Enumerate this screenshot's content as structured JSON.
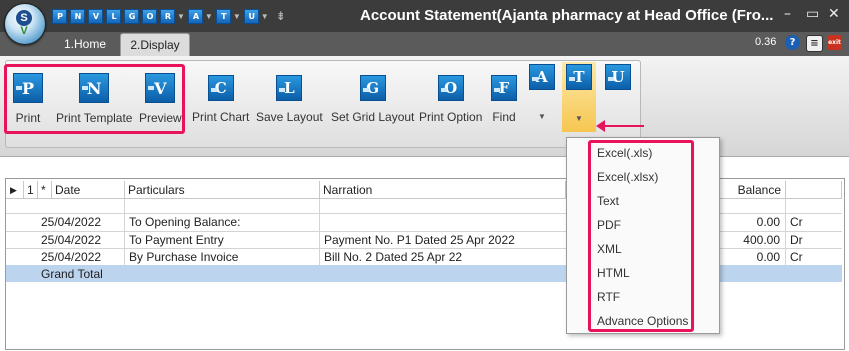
{
  "app": {
    "title": "Account Statement(Ajanta pharmacy  at Head Office (Fro...",
    "qat": [
      "P",
      "N",
      "V",
      "L",
      "G",
      "O",
      "R",
      "A",
      "T",
      "U"
    ],
    "qat_with_dropdown": [
      "R",
      "A",
      "T"
    ],
    "window_controls": {
      "minimize": "–",
      "maximize": "▭",
      "close": "✕"
    }
  },
  "tabs": [
    {
      "label": "1.Home",
      "active": false
    },
    {
      "label": "2.Display",
      "active": true
    }
  ],
  "header_right": {
    "zoom": "0.36",
    "help_icon": "?",
    "doc_icon": "≡",
    "exit_icon": "exit"
  },
  "ribbon": {
    "buttons": [
      {
        "id": "print",
        "icon": "P",
        "label": "Print"
      },
      {
        "id": "print_template",
        "icon": "N",
        "label": "Print Template"
      },
      {
        "id": "preview",
        "icon": "V",
        "label": "Preview"
      },
      {
        "id": "print_chart",
        "icon": "C",
        "label": "Print Chart"
      },
      {
        "id": "save_layout",
        "icon": "L",
        "label": "Save Layout"
      },
      {
        "id": "set_grid_layout",
        "icon": "G",
        "label": "Set Grid Layout"
      },
      {
        "id": "print_option",
        "icon": "O",
        "label": "Print Option"
      },
      {
        "id": "find",
        "icon": "F",
        "label": "Find"
      },
      {
        "id": "a",
        "icon": "A",
        "label": ""
      },
      {
        "id": "t",
        "icon": "T",
        "label": ""
      },
      {
        "id": "u",
        "icon": "U",
        "label": ""
      }
    ]
  },
  "grid": {
    "headers": {
      "indicator": "▶",
      "col1": "1",
      "col_star": "*",
      "date": "Date",
      "particulars": "Particulars",
      "narration": "Narration",
      "balance": "Balance"
    },
    "rows": [
      {
        "date": "25/04/2022",
        "particulars": "To Opening Balance:",
        "narration": "",
        "balance": "0.00",
        "drcr": "Cr"
      },
      {
        "date": "25/04/2022",
        "particulars": "To Payment Entry",
        "narration": "Payment No. P1 Dated 25 Apr 2022",
        "balance": "400.00",
        "drcr": "Dr"
      },
      {
        "date": "25/04/2022",
        "particulars": "By Purchase Invoice",
        "narration": "Bill No. 2 Dated 25 Apr 22",
        "balance": "0.00",
        "drcr": "Cr"
      }
    ],
    "grand_total": "Grand Total"
  },
  "export_menu": {
    "items": [
      "Excel(.xls)",
      "Excel(.xlsx)",
      "Text",
      "PDF",
      "XML",
      "HTML",
      "RTF",
      "Advance Options"
    ]
  },
  "colors": {
    "highlight": "#e8145a",
    "titlebar": "#3c3c3c",
    "icon_blue": "#1a78c8",
    "total_row": "#bcd4ee"
  }
}
